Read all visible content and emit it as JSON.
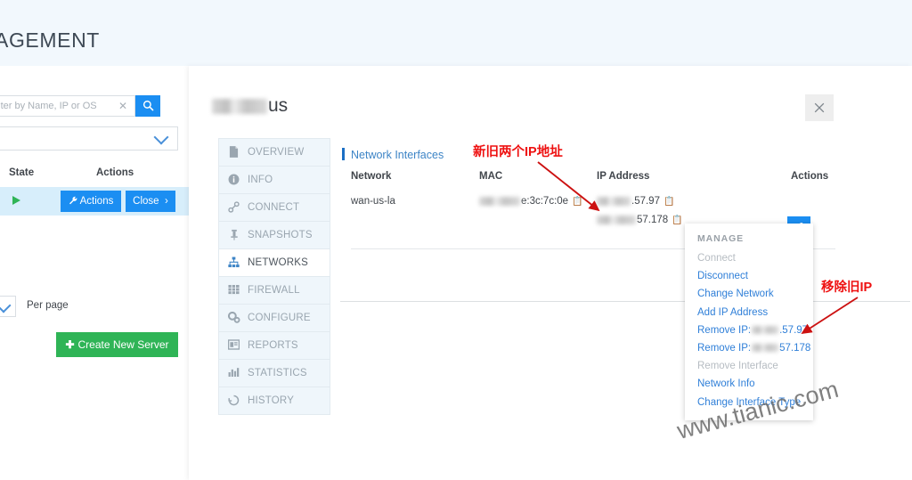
{
  "header": {
    "title": "AGEMENT",
    "background": "#f2f8fd"
  },
  "left_panel": {
    "search": {
      "placeholder": "Filter by Name, IP or OS",
      "clear_icon": "close-x-icon",
      "search_icon": "search-icon"
    },
    "filter_select": {
      "value": "",
      "chevron_icon": "chevron-down-icon"
    },
    "table_headers": {
      "state": "State",
      "actions": "Actions"
    },
    "row": {
      "state_icon": "play-running-icon",
      "actions_label": "Actions",
      "actions_icon": "wrench-icon",
      "close_label": "Close",
      "close_icon": "chevron-right-icon"
    },
    "pagination": {
      "per_page_label": "Per page",
      "chevron_icon": "chevron-down-icon"
    },
    "create_button": {
      "label": "Create New Server",
      "icon": "plus-icon",
      "color": "#2fb456"
    }
  },
  "detail_panel": {
    "server_name_suffix": "us",
    "close_icon": "close-x-icon",
    "tabs": [
      {
        "label": "OVERVIEW",
        "icon": "document-icon",
        "active": false
      },
      {
        "label": "INFO",
        "icon": "info-icon",
        "active": false
      },
      {
        "label": "CONNECT",
        "icon": "link-icon",
        "active": false
      },
      {
        "label": "SNAPSHOTS",
        "icon": "pin-icon",
        "active": false
      },
      {
        "label": "NETWORKS",
        "icon": "network-icon",
        "active": true
      },
      {
        "label": "FIREWALL",
        "icon": "firewall-icon",
        "active": false
      },
      {
        "label": "CONFIGURE",
        "icon": "gears-icon",
        "active": false
      },
      {
        "label": "REPORTS",
        "icon": "report-icon",
        "active": false
      },
      {
        "label": "STATISTICS",
        "icon": "bar-chart-icon",
        "active": false
      },
      {
        "label": "HISTORY",
        "icon": "history-icon",
        "active": false
      }
    ],
    "section_heading": "Network Interfaces",
    "table": {
      "columns": [
        "Network",
        "MAC",
        "IP Address",
        "Actions"
      ],
      "rows": [
        {
          "network": "wan-us-la",
          "mac": "e:3c:7c:0e",
          "mac_copy_icon": "copy-icon",
          "ips": [
            {
              "value": ".57.97",
              "copy_icon": "copy-icon"
            },
            {
              "value": "57.178",
              "copy_icon": "copy-icon"
            }
          ],
          "action_icon": "wrench-icon"
        }
      ]
    },
    "manage_menu": {
      "title": "MANAGE",
      "items": [
        {
          "label": "Connect",
          "disabled": true
        },
        {
          "label": "Disconnect",
          "disabled": false
        },
        {
          "label": "Change Network",
          "disabled": false
        },
        {
          "label": "Add IP Address",
          "disabled": false
        },
        {
          "label": "Remove IP:",
          "disabled": false,
          "suffix": ".57.97",
          "blurred": true
        },
        {
          "label": "Remove IP:",
          "disabled": false,
          "suffix": "57.178",
          "blurred": true
        },
        {
          "label": "Remove Interface",
          "disabled": true
        },
        {
          "label": "Network Info",
          "disabled": false
        },
        {
          "label": "Change Interface Type",
          "disabled": false
        }
      ]
    }
  },
  "annotations": {
    "color": "#ee1111",
    "note_ip_addresses": "新旧两个IP地址",
    "note_remove_old_ip": "移除旧IP"
  },
  "watermark": {
    "text": "www.tianic.com"
  }
}
